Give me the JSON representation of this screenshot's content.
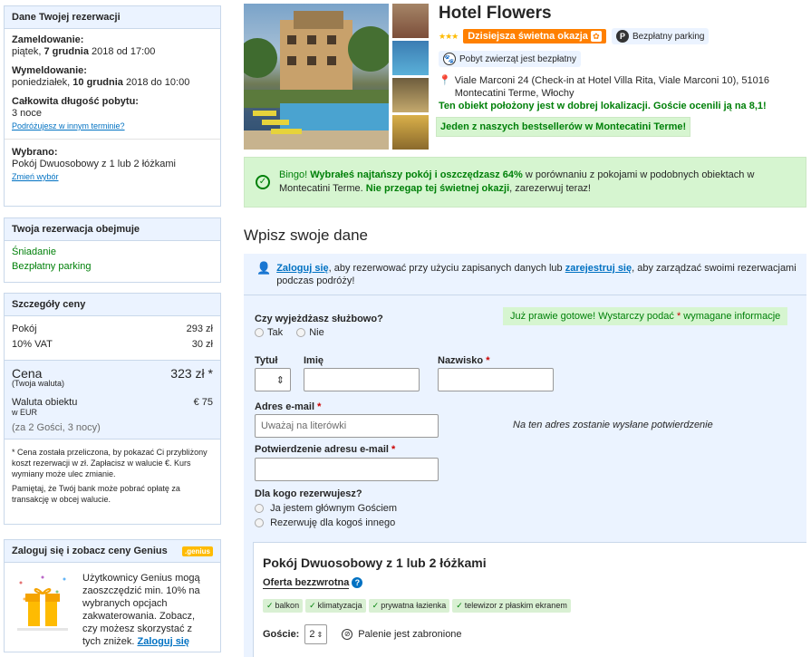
{
  "booking": {
    "header": "Dane Twojej rezerwacji",
    "checkin_label": "Zameldowanie:",
    "checkin_day": "piątek, ",
    "checkin_date": "7 grudnia",
    "checkin_rest": " 2018 od 17:00",
    "checkout_label": "Wymeldowanie:",
    "checkout_day": "poniedziałek, ",
    "checkout_date": "10 grudnia",
    "checkout_rest": " 2018 do 10:00",
    "length_label": "Całkowita długość pobytu:",
    "length_value": "3 noce",
    "other_dates_link": "Podróżujesz w innym terminie?",
    "selected_label": "Wybrano:",
    "selected_value": "Pokój Dwuosobowy z 1 lub 2 łóżkami",
    "change_link": "Zmień wybór"
  },
  "includes": {
    "header": "Twoja rezerwacja obejmuje",
    "items": [
      "Śniadanie",
      "Bezpłatny parking"
    ]
  },
  "price": {
    "header": "Szczegóły ceny",
    "rows": [
      {
        "label": "Pokój",
        "value": "293 zł"
      },
      {
        "label": "10% VAT",
        "value": "30 zł"
      }
    ],
    "total_label": "Cena",
    "total_value": "323 zł *",
    "total_sub": "(Twoja waluta)",
    "prop_label": "Waluta obiektu",
    "prop_sub": "w EUR",
    "prop_value": "€ 75",
    "guests_note": "(za 2 Gości, 3 nocy)",
    "note1": "* Cena została przeliczona, by pokazać Ci przybliżony koszt rezerwacji w zł. Zapłacisz w walucie €. Kurs wymiany może ulec zmianie.",
    "note2": "Pamiętaj, że Twój bank może pobrać opłatę za transakcję w obcej walucie."
  },
  "genius": {
    "header": "Zaloguj się i zobacz ceny Genius",
    "badge": ".genius",
    "text": "Użytkownicy Genius mogą zaoszczędzić min. 10% na wybranych opcjach zakwaterowania. Zobacz, czy możesz skorzystać z tych zniżek. ",
    "link": "Zaloguj się"
  },
  "hotel": {
    "name": "Hotel Flowers",
    "stars": "★★★",
    "deal": "Dzisiejsza świetna okazja",
    "parking": "Bezpłatny parking",
    "pets": "Pobyt zwierząt jest bezpłatny",
    "address": "Viale Marconi 24 (Check-in at Hotel Villa Rita, Viale Marconi 10), 51016 Montecatini Terme, Włochy",
    "location_note": "Ten obiekt położony jest w dobrej lokalizacji. Goście ocenili ją na 8,1!",
    "bestseller": "Jeden z naszych bestsellerów w Montecatini Terme!"
  },
  "bingo": {
    "lead": "Bingo! ",
    "bold1": "Wybrałeś najtańszy pokój i oszczędzasz 64%",
    "mid": " w porównaniu z pokojami w podobnych obiektach w Montecatini Terme. ",
    "bold2": "Nie przegap tej świetnej okazji",
    "end": ", zarezerwuj teraz!"
  },
  "form": {
    "title": "Wpisz swoje dane",
    "signin_link": "Zaloguj się",
    "signin_mid": ", aby rezerwować przy użyciu zapisanych danych lub ",
    "register_link": "zarejestruj się",
    "signin_end": ", aby zarządzać swoimi rezerwacjami podczas podróży!",
    "almost_done": "Już prawie gotowe! Wystarczy podać ",
    "almost_done_end": " wymagane informacje",
    "business_q": "Czy wyjeżdżasz służbowo?",
    "yes": "Tak",
    "no": "Nie",
    "title_label": "Tytuł",
    "first_label": "Imię",
    "last_label": "Nazwisko",
    "email_label": "Adres e-mail",
    "email_placeholder": "Uważaj na literówki",
    "email_hint": "Na ten adres zostanie wysłane potwierdzenie",
    "confirm_label": "Potwierdzenie adresu e-mail",
    "for_whom": "Dla kogo rezerwujesz?",
    "main_guest": "Ja jestem głównym Gościem",
    "someone_else": "Rezerwuję dla kogoś innego",
    "asterisk": "*"
  },
  "room": {
    "title": "Pokój Dwuosobowy z 1 lub 2 łóżkami",
    "offer": "Oferta bezzwrotna",
    "facilities": [
      "balkon",
      "klimatyzacja",
      "prywatna łazienka",
      "telewizor z płaskim ekranem"
    ],
    "guests_label": "Goście:",
    "guests_value": "2",
    "smoking": "Palenie jest zabronione"
  },
  "colors": {
    "accent": "#0071c2",
    "green": "#008009",
    "deal": "#ff8000",
    "panel": "#ebf3ff"
  }
}
